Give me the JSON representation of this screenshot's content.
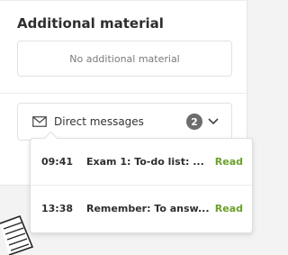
{
  "additional_material": {
    "title": "Additional material",
    "empty_text": "No additional material"
  },
  "direct_messages": {
    "label": "Direct messages",
    "count": "2",
    "messages": [
      {
        "time": "09:41",
        "text": "Exam 1: To-do list: ...",
        "status": "Read"
      },
      {
        "time": "13:38",
        "text": "Remember: To answ...",
        "status": "Read"
      }
    ]
  },
  "colors": {
    "read_status": "#6aa02a",
    "badge": "#6d6d6d"
  },
  "icons": {
    "mail": "mail-icon",
    "chevron": "chevron-down-icon",
    "illustration": "notebook-illustration"
  }
}
